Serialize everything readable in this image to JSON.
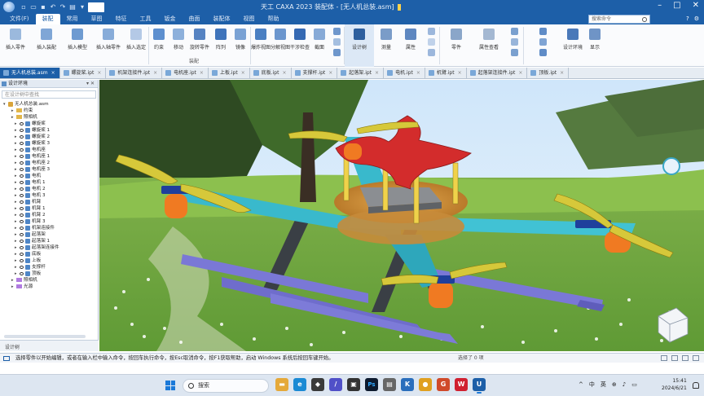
{
  "window": {
    "title": "天工 CAXA 2023 装配体 - [无人机总装.asm]",
    "colors": {
      "brand": "#1d5fa8",
      "status_bg": "#f1f4f8"
    }
  },
  "menubar": {
    "items": [
      "文件(F)",
      "装配",
      "常用",
      "草图",
      "特征",
      "工具",
      "钣金",
      "曲面",
      "装配体",
      "视图",
      "帮助"
    ],
    "active_index": 1,
    "search_placeholder": "搜索命令"
  },
  "ribbon": {
    "buttons": [
      "插入零件",
      "插入装配",
      "插入模型",
      "插入轴零件",
      "插入选定",
      "约束",
      "移动",
      "旋转零件",
      "阵列",
      "镜像",
      "爆炸视图",
      "分解视图",
      "干涉检查",
      "截面",
      "装配特性",
      "设计树",
      "测量",
      "属性",
      "渲染",
      "零件",
      "属性查看",
      "零件设计",
      "配置",
      "设计环境",
      "显示"
    ],
    "group_label": "装配"
  },
  "doc_tabs": [
    {
      "label": "无人机总装.asm",
      "active": true
    },
    {
      "label": "螺旋桨.ipt"
    },
    {
      "label": "机架连接件.ipt"
    },
    {
      "label": "电机座.ipt"
    },
    {
      "label": "上板.ipt"
    },
    {
      "label": "底板.ipt"
    },
    {
      "label": "支撑杆.ipt"
    },
    {
      "label": "起落架.ipt"
    },
    {
      "label": "电机.ipt"
    },
    {
      "label": "机臂.ipt"
    },
    {
      "label": "起落架连接件.ipt"
    },
    {
      "label": "顶板.ipt"
    }
  ],
  "tree": {
    "header": "设计环境",
    "find_placeholder": "在设计树中查找",
    "root": "无人机总装.asm",
    "items": [
      "螺旋桨",
      "螺旋桨 1",
      "螺旋桨 2",
      "螺旋桨 3",
      "电机座",
      "电机座 1",
      "电机座 2",
      "电机座 3",
      "电机",
      "电机 1",
      "电机 2",
      "电机 3",
      "机臂",
      "机臂 1",
      "机臂 2",
      "机臂 3",
      "机架连接件",
      "起落架",
      "起落架 1",
      "起落架连接件",
      "底板",
      "上板",
      "支撑杆",
      "顶板"
    ],
    "folders": [
      "约束",
      "照相机",
      "光源"
    ],
    "bottom_label": "设计树"
  },
  "status": {
    "message": "选择零件以开始编辑，或者在输入栏中输入命令，按回车执行命令，按Esc取消命令，按F1获取帮助，启动 Windows 系统后按回车键开始。",
    "selection": "选择了 0 项"
  },
  "taskbar": {
    "search_placeholder": "搜索",
    "apps": [
      {
        "icon": "file-explorer-icon",
        "color": "#e5a93a",
        "glyph": "▬"
      },
      {
        "icon": "edge-icon",
        "color": "#1a8ad4",
        "glyph": "e"
      },
      {
        "icon": "app-icon",
        "color": "#3a3a3a",
        "glyph": "◆"
      },
      {
        "icon": "app-icon",
        "color": "#5050c8",
        "glyph": "/"
      },
      {
        "icon": "app-icon",
        "color": "#333",
        "glyph": "▣"
      },
      {
        "icon": "ps-icon",
        "color": "#0d1a2e",
        "glyph": "Ps"
      },
      {
        "icon": "app-icon",
        "color": "#666",
        "glyph": "▤"
      },
      {
        "icon": "app-icon",
        "color": "#2a6ebc",
        "glyph": "K"
      },
      {
        "icon": "chrome-icon",
        "color": "#e0a020",
        "glyph": "●"
      },
      {
        "icon": "app-icon",
        "color": "#d04a2a",
        "glyph": "G"
      },
      {
        "icon": "wps-icon",
        "color": "#d02030",
        "glyph": "W"
      },
      {
        "icon": "app-icon",
        "color": "#1d5fa8",
        "glyph": "U",
        "running": true
      }
    ],
    "tray": [
      "^",
      "中",
      "英",
      "⊕",
      "♪",
      "▭"
    ],
    "time": "15:41",
    "date": "2024/6/21"
  }
}
